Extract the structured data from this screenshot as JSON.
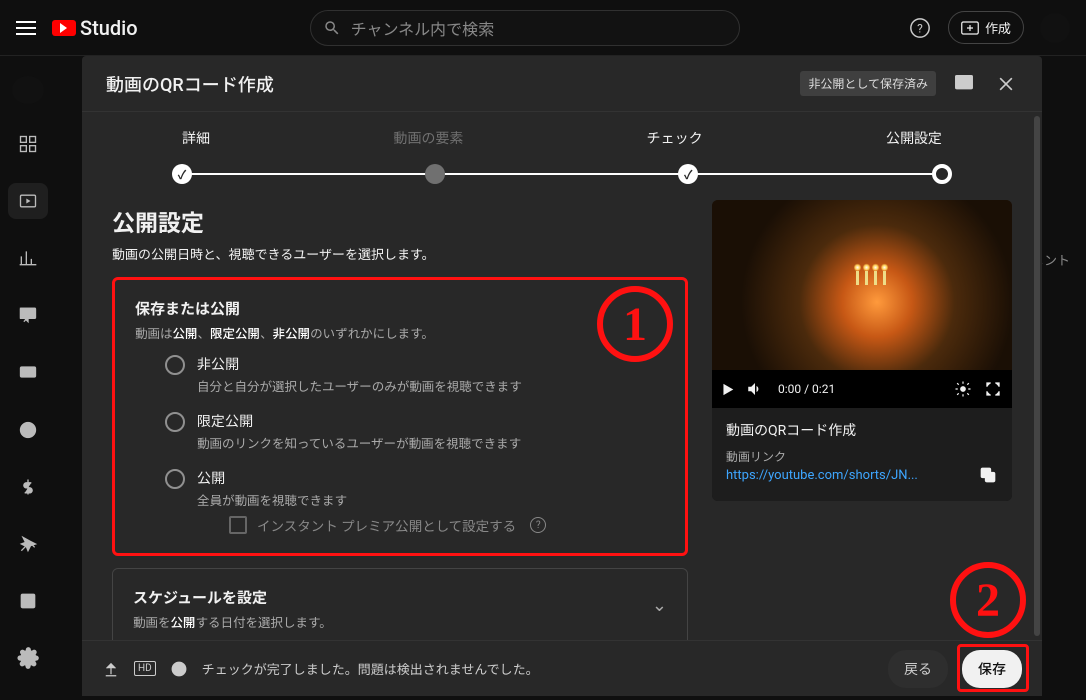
{
  "topbar": {
    "brand": "Studio",
    "search_placeholder": "チャンネル内で検索",
    "create_label": "作成"
  },
  "dialog": {
    "title": "動画のQRコード作成",
    "saved_badge": "非公開として保存済み",
    "steps": {
      "detail": "詳細",
      "elements": "動画の要素",
      "check": "チェック",
      "visibility": "公開設定"
    },
    "section_title": "公開設定",
    "section_sub": "動画の公開日時と、視聴できるユーザーを選択します。",
    "save_publish": {
      "title": "保存または公開",
      "desc_pre": "動画は",
      "opt_public": "公開",
      "sep1": "、",
      "opt_unlisted": "限定公開",
      "sep2": "、",
      "opt_private": "非公開",
      "desc_post": "のいずれかにします。"
    },
    "radios": {
      "private_t": "非公開",
      "private_d": "自分と自分が選択したユーザーのみが動画を視聴できます",
      "unlisted_t": "限定公開",
      "unlisted_d": "動画のリンクを知っているユーザーが動画を視聴できます",
      "public_t": "公開",
      "public_d": "全員が動画を視聴できます",
      "premiere": "インスタント プレミア公開として設定する"
    },
    "schedule": {
      "title": "スケジュールを設定",
      "desc_pre": "動画を",
      "strong": "公開",
      "desc_post": "する日付を選択します。"
    },
    "preview": {
      "time": "0:00 / 0:21",
      "title": "動画のQRコード作成",
      "link_label": "動画リンク",
      "link_url": "https://youtube.com/shorts/JN..."
    },
    "footer": {
      "hd": "HD",
      "checks_msg": "チェックが完了しました。問題は検出されませんでした。",
      "back": "戻る",
      "save": "保存"
    }
  },
  "annotations": {
    "one": "1",
    "two": "2"
  },
  "bg_text": "メント"
}
